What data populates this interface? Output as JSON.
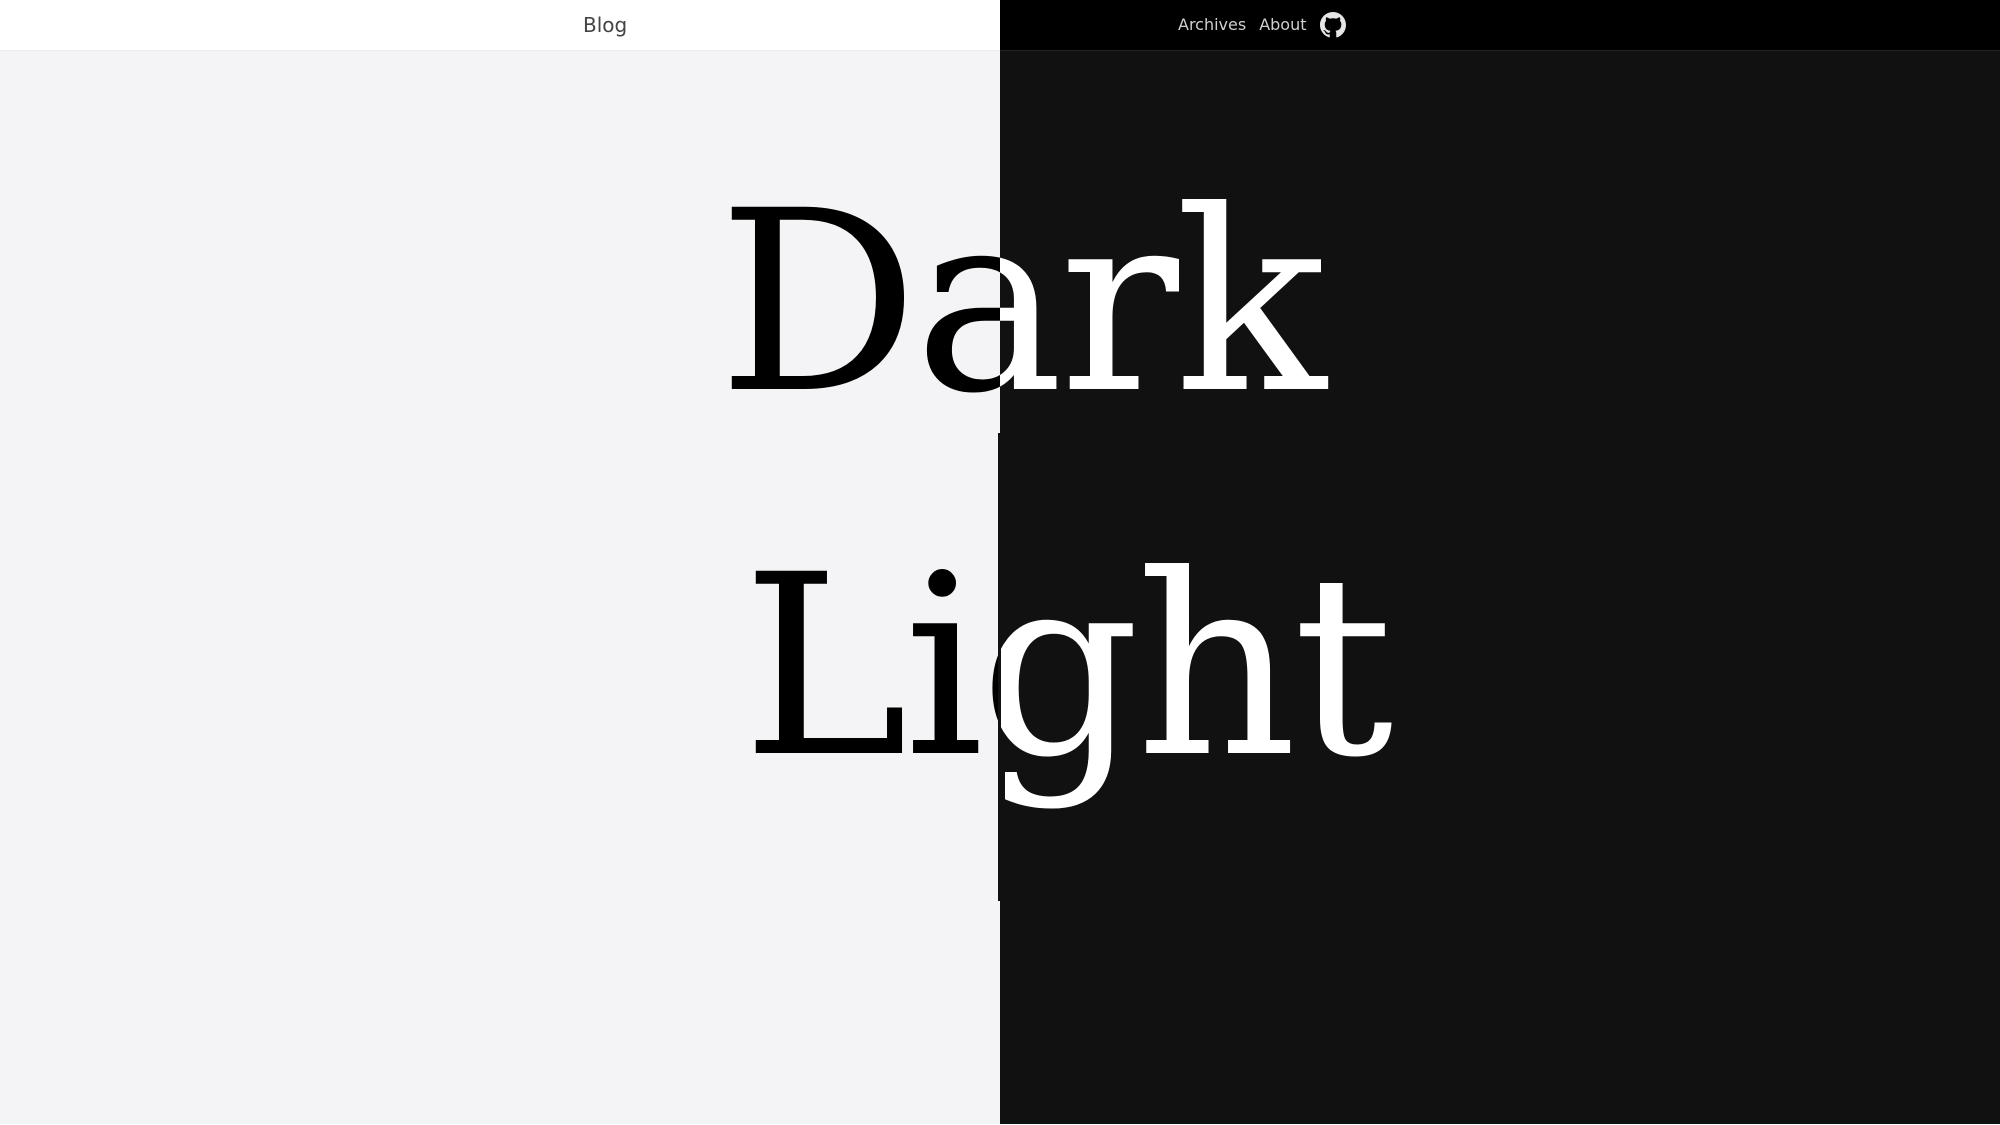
{
  "header": {
    "blog_title": "Blog",
    "nav": [
      "Archives",
      "About"
    ],
    "github_icon": "github-icon"
  },
  "reading_progress": 0.5,
  "hero": {
    "line1": "Dark",
    "line2": "Light"
  },
  "colors": {
    "light_bg": "#f4f4f6",
    "dark_bg": "#111111",
    "accent": "#3b7fd9"
  }
}
